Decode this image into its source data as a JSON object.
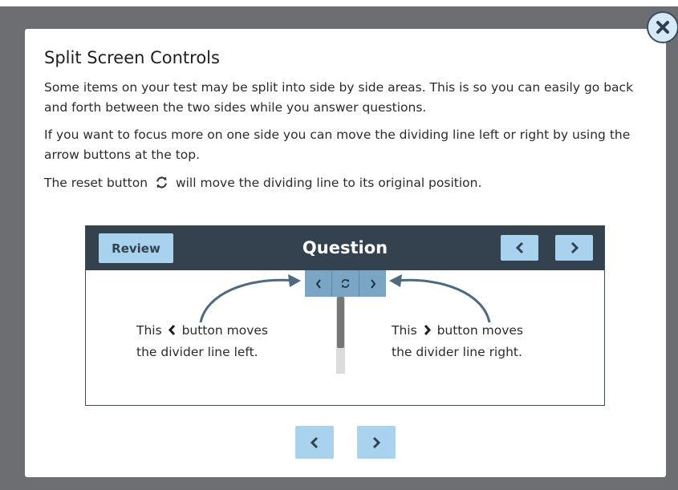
{
  "dialog": {
    "title": "Split Screen Controls",
    "paragraph1": "Some items on your test may be split into side by side areas. This is so you can easily go back and forth between the two sides while you answer questions.",
    "paragraph2": "If you want to focus more on one side you can move the dividing line left or right by using the arrow buttons at the top.",
    "paragraph3_before": "The reset button",
    "paragraph3_after": "will move the dividing line to its original position."
  },
  "demo": {
    "review_label": "Review",
    "header_title": "Question",
    "left_caption_before": "This",
    "left_caption_after": "button moves",
    "left_caption_line2": "the divider line left.",
    "right_caption_before": "This",
    "right_caption_after": "button moves",
    "right_caption_line2": "the divider line right."
  },
  "colors": {
    "header": "#34414f",
    "button": "#a9d2ef",
    "divider_controls": "#7aa5c4",
    "arrow": "#4f6a80"
  },
  "icons": {
    "close": "close-x-icon",
    "reset": "reset-icon",
    "prev": "chevron-left-icon",
    "next": "chevron-right-icon"
  }
}
